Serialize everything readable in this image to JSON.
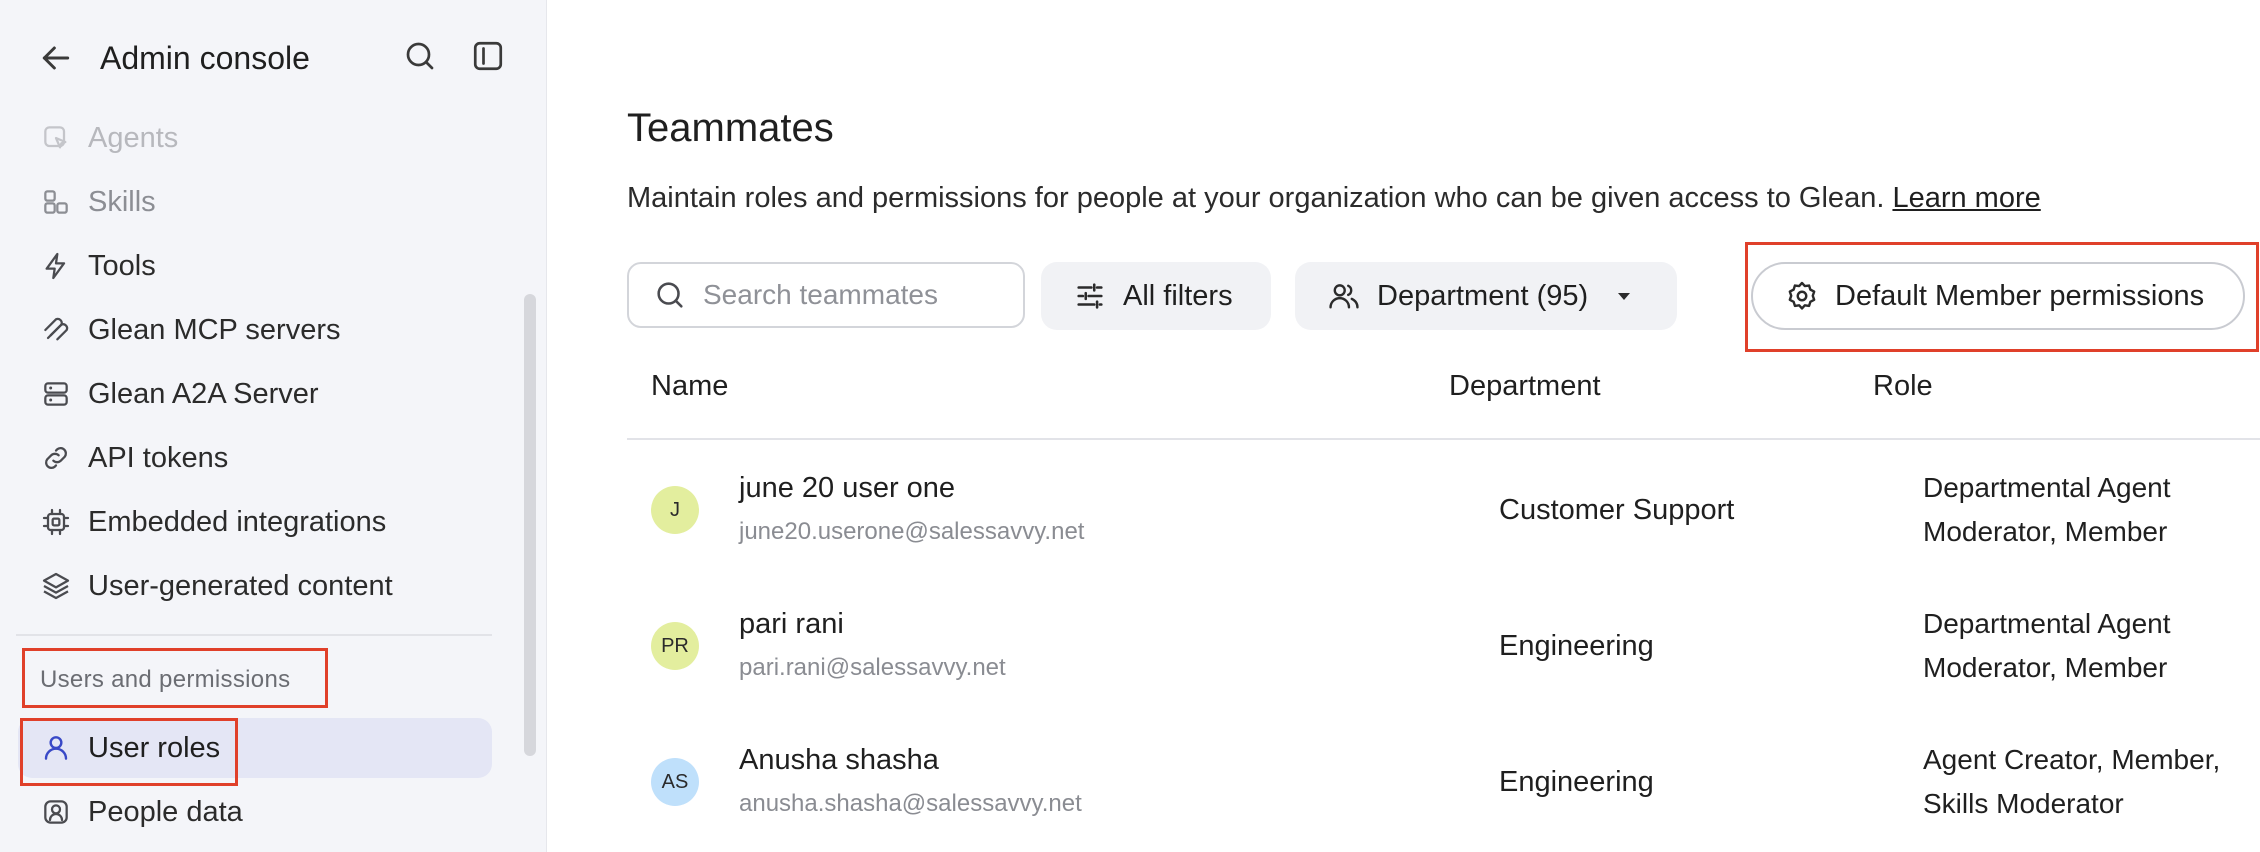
{
  "sidebar": {
    "title": "Admin console",
    "items": [
      {
        "label": "Agents",
        "icon": "agents-icon"
      },
      {
        "label": "Skills",
        "icon": "skills-icon"
      },
      {
        "label": "Tools",
        "icon": "bolt-icon"
      },
      {
        "label": "Glean MCP servers",
        "icon": "mcp-icon"
      },
      {
        "label": "Glean A2A Server",
        "icon": "server-icon"
      },
      {
        "label": "API tokens",
        "icon": "link-icon"
      },
      {
        "label": "Embedded integrations",
        "icon": "chip-icon"
      },
      {
        "label": "User-generated content",
        "icon": "layers-icon"
      }
    ],
    "section_label": "Users and permissions",
    "section_items": [
      {
        "label": "User roles",
        "icon": "user-icon",
        "active": true
      },
      {
        "label": "People data",
        "icon": "person-badge-icon"
      }
    ]
  },
  "main": {
    "title": "Teammates",
    "description": "Maintain roles and permissions for people at your organization who can be given access to Glean.",
    "learn_more": "Learn more",
    "search_placeholder": "Search teammates",
    "filters_label": "All filters",
    "department_filter_label": "Department (95)",
    "default_permissions_label": "Default Member permissions",
    "columns": {
      "name": "Name",
      "department": "Department",
      "role": "Role"
    },
    "rows": [
      {
        "initials": "J",
        "avatar_color": "#e3ee9e",
        "name": "june 20 user one",
        "email": "june20.userone@salessavvy.net",
        "department": "Customer Support",
        "role": "Departmental Agent Moderator, Member"
      },
      {
        "initials": "PR",
        "avatar_color": "#e3ee9e",
        "name": "pari rani",
        "email": "pari.rani@salessavvy.net",
        "department": "Engineering",
        "role": "Departmental Agent Moderator, Member"
      },
      {
        "initials": "AS",
        "avatar_color": "#bfe0fb",
        "name": "Anusha shasha",
        "email": "anusha.shasha@salessavvy.net",
        "department": "Engineering",
        "role": "Agent Creator, Member, Skills Moderator"
      }
    ]
  },
  "colors": {
    "highlight": "#e0402a",
    "active_nav": "#e4e6f5",
    "sidebar_bg": "#f4f5f9"
  }
}
